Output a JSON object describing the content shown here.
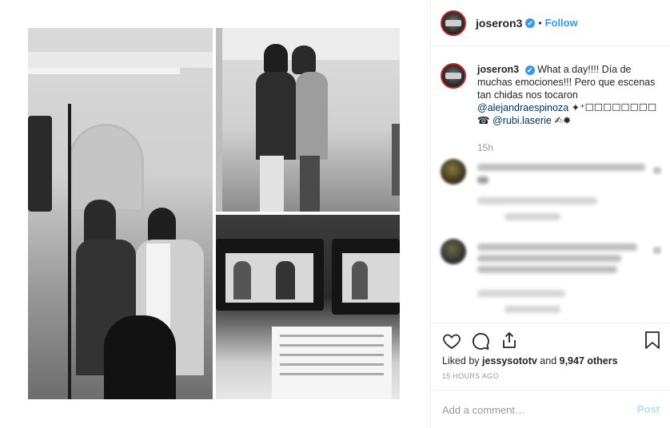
{
  "post": {
    "username": "joseron3",
    "follow_label": "Follow",
    "dot": "•",
    "verified_glyph": "✔",
    "caption_text": "What a day!!!! Día de muchas emociones!!! Pero que escenas tan chidas nos tocaron",
    "mention_1": "@alejandraespinoza",
    "mention_1_suffix": " ✦⁺☐☐☐☐☐☐☐☐",
    "mention_2_prefix": "☎ ",
    "mention_2": "@rubi.laserie",
    "mention_2_suffix": " ✍✸",
    "caption_time": "15h",
    "likes_prefix": "Liked by ",
    "likes_user": "jessysototv",
    "likes_suffix": " and ",
    "likes_count": "9,947 others",
    "time_ago": "15 HOURS AGO",
    "add_comment_placeholder": "Add a comment…",
    "post_label": "Post"
  },
  "icons": [
    "heart-icon",
    "comment-icon",
    "share-icon",
    "bookmark-icon",
    "verified-icon"
  ],
  "colors": {
    "link": "#3897f0",
    "mention": "#003569",
    "muted": "#999999",
    "post_disabled": "#b2dffc",
    "avatar_ring": "#c62828"
  }
}
